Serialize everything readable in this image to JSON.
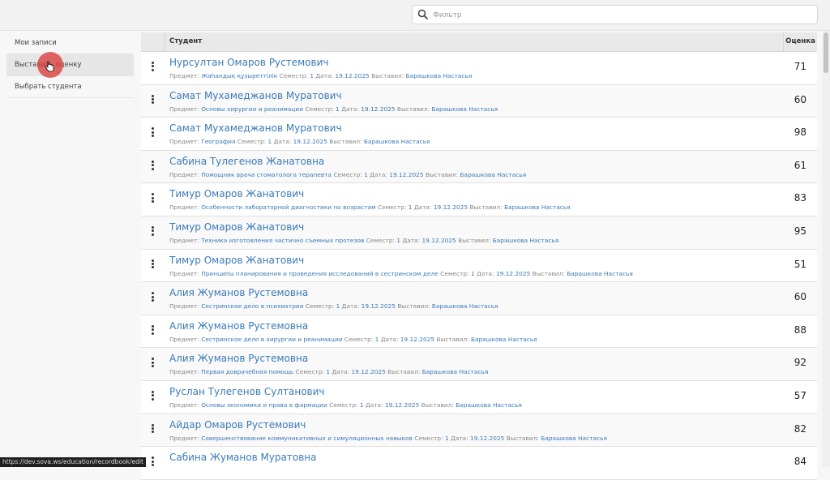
{
  "search": {
    "placeholder": "Фильтр",
    "value": ""
  },
  "sidebar": {
    "items": [
      {
        "label": "Мои записи"
      },
      {
        "label": "Выставить оценку"
      },
      {
        "label": "Выбрать студента"
      }
    ]
  },
  "table": {
    "headers": {
      "student": "Студент",
      "grade": "Оценка"
    },
    "meta_labels": {
      "subject": "Предмет:",
      "semester": "Семестр:",
      "date": "Дата:",
      "issuer": "Выставил:"
    },
    "rows": [
      {
        "student": "Нурсултан Омаров Рустемович",
        "subject": "Жаһандық құзыреттілік",
        "semester": "1",
        "date": "19.12.2025",
        "issuer": "Барашкова Настасья",
        "grade": "71"
      },
      {
        "student": "Самат Мухамеджанов Муратович",
        "subject": "Основы хирургии и реанимации",
        "semester": "1",
        "date": "19.12.2025",
        "issuer": "Барашкова Настасья",
        "grade": "60"
      },
      {
        "student": "Самат Мухамеджанов Муратович",
        "subject": "География",
        "semester": "1",
        "date": "19.12.2025",
        "issuer": "Барашкова Настасья",
        "grade": "98"
      },
      {
        "student": "Сабина Тулегенов Жанатовна",
        "subject": "Помощник врача стоматолога терапевта",
        "semester": "1",
        "date": "19.12.2025",
        "issuer": "Барашкова Настасья",
        "grade": "61"
      },
      {
        "student": "Тимур Омаров Жанатович",
        "subject": "Особенности лабораторной диагностики по возрастам",
        "semester": "1",
        "date": "19.12.2025",
        "issuer": "Барашкова Настасья",
        "grade": "83"
      },
      {
        "student": "Тимур Омаров Жанатович",
        "subject": "Техника изготовления частично съемных протезов",
        "semester": "1",
        "date": "19.12.2025",
        "issuer": "Барашкова Настасья",
        "grade": "95"
      },
      {
        "student": "Тимур Омаров Жанатович",
        "subject": "Принципы планирования и проведения исследований в сестринском деле",
        "semester": "1",
        "date": "19.12.2025",
        "issuer": "Барашкова Настасья",
        "grade": "51"
      },
      {
        "student": "Алия Жуманов Рустемовна",
        "subject": "Сестринское дело в психиатрии",
        "semester": "1",
        "date": "19.12.2025",
        "issuer": "Барашкова Настасья",
        "grade": "60"
      },
      {
        "student": "Алия Жуманов Рустемовна",
        "subject": "Сестринское дело в хирургии и реанимации",
        "semester": "1",
        "date": "19.12.2025",
        "issuer": "Барашкова Настасья",
        "grade": "88"
      },
      {
        "student": "Алия Жуманов Рустемовна",
        "subject": "Первая доврачебная помощь",
        "semester": "1",
        "date": "19.12.2025",
        "issuer": "Барашкова Настасья",
        "grade": "92"
      },
      {
        "student": "Руслан Тулегенов Султанович",
        "subject": "Основы экономики и права в фармации",
        "semester": "1",
        "date": "19.12.2025",
        "issuer": "Барашкова Настасья",
        "grade": "57"
      },
      {
        "student": "Айдар Омаров Рустемович",
        "subject": "Совершенствование коммуникативных и симуляционных навыков",
        "semester": "1",
        "date": "19.12.2025",
        "issuer": "Барашкова Настасья",
        "grade": "82"
      },
      {
        "student": "Сабина Жуманов Муратовна",
        "subject": "",
        "semester": "",
        "date": "",
        "issuer": "",
        "grade": "84"
      }
    ]
  },
  "status_bar": {
    "url": "https://dev.sova.ws/education/recordbook/edit"
  },
  "colors": {
    "link": "#3a7ab8",
    "cursor": "#dc3c3c"
  },
  "icons": {
    "search": "search-icon",
    "row_menu": "kebab-menu-icon",
    "pointer": "hand-pointer-icon"
  }
}
